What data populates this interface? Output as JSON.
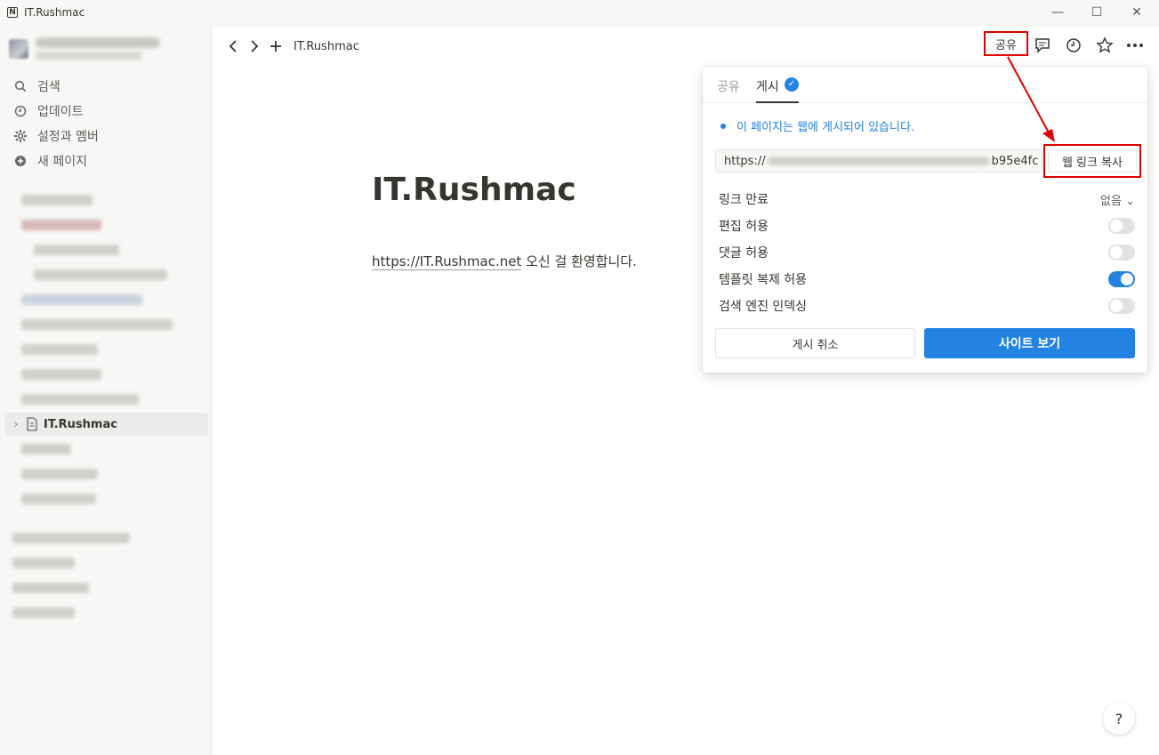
{
  "window": {
    "title": "IT.Rushmac",
    "minimize": "—",
    "maximize": "☐",
    "close": "✕"
  },
  "sidebar": {
    "nav": [
      {
        "label": "검색",
        "icon": "search-icon"
      },
      {
        "label": "업데이트",
        "icon": "clock-icon"
      },
      {
        "label": "설정과 멤버",
        "icon": "gear-icon"
      },
      {
        "label": "새 페이지",
        "icon": "plus-circle-icon"
      }
    ],
    "active_page": "IT.Rushmac"
  },
  "topbar": {
    "breadcrumb": "IT.Rushmac",
    "share_label": "공유"
  },
  "page": {
    "title": "IT.Rushmac",
    "body_link": "https://IT.Rushmac.net",
    "body_text": " 오신 걸 환영합니다."
  },
  "popover": {
    "tab_share": "공유",
    "tab_publish": "게시",
    "status": "이 페이지는 웹에 게시되어 있습니다.",
    "url_prefix": "https://",
    "url_suffix": "b95e4fc",
    "copy_button": "웹 링크 복사",
    "options": [
      {
        "label": "링크 만료",
        "value": "없음"
      },
      {
        "label": "편집 허용",
        "enabled": false
      },
      {
        "label": "댓글 허용",
        "enabled": false
      },
      {
        "label": "템플릿 복제 허용",
        "enabled": true
      },
      {
        "label": "검색 엔진 인덱싱",
        "enabled": false
      }
    ],
    "unpublish_button": "게시 취소",
    "view_site_button": "사이트 보기"
  },
  "help": "?",
  "colors": {
    "accent": "#2383e2",
    "annotation": "#e00000"
  }
}
